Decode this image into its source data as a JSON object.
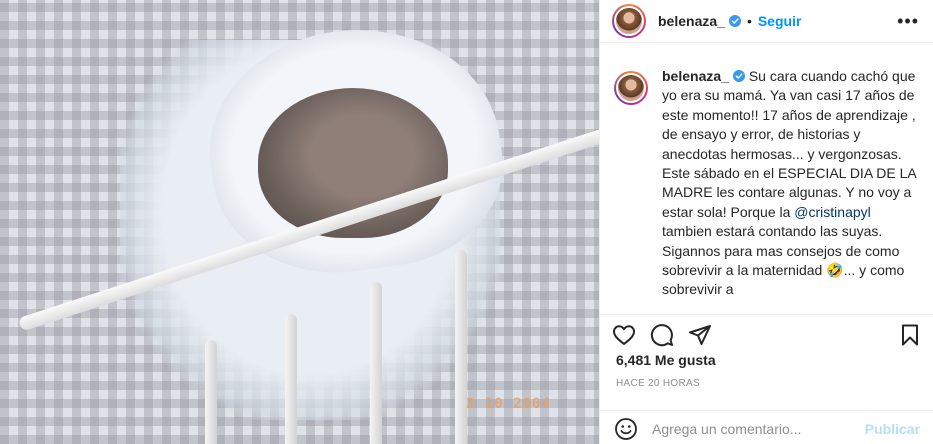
{
  "post": {
    "photo_stamp": "3 10 2004"
  },
  "header": {
    "username": "belenaza_",
    "separator": "•",
    "follow_label": "Seguir",
    "more_label": "•••"
  },
  "caption": {
    "username": "belenaza_",
    "text_part1": " Su cara cuando cachó que yo era su mamá. Ya van casi 17 años de este momento!! 17 años de aprendizaje , de ensayo y error, de historias y anecdotas hermosas... y vergonzosas. Este sábado en el ESPECIAL DIA DE LA MADRE les contare algunas. Y no voy a estar sola! Porque la ",
    "mention": "@cristinapyl",
    "text_part2": " tambien estará contando las suyas. Sigannos para mas consejos de como sobrevivir a la maternidad 🤣... y como sobrevivir a"
  },
  "actions": {
    "icons": [
      "heart-icon",
      "comment-icon",
      "share-icon",
      "bookmark-icon"
    ]
  },
  "likes_label": "6,481 Me gusta",
  "timestamp": "HACE 20 HORAS",
  "comment_box": {
    "placeholder": "Agrega un comentario...",
    "publish_label": "Publicar"
  },
  "colors": {
    "accent": "#0095f6",
    "publish_disabled": "#b2dffc",
    "mention": "#00376b",
    "secondary_text": "#8e8e8e"
  }
}
